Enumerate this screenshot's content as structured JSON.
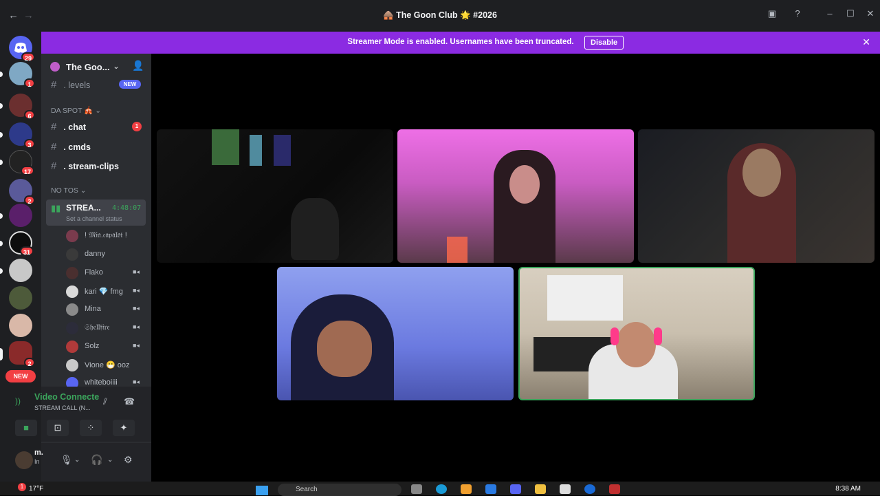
{
  "window": {
    "title": "🛖 The Goon Club 🌟 #2026",
    "back": "←",
    "forward": "→"
  },
  "banner": {
    "text": "Streamer Mode is enabled. Usernames have been truncated.",
    "button": "Disable"
  },
  "rail": {
    "home_badge": "29",
    "servers": [
      {
        "badge": "1"
      },
      {
        "badge": "6"
      },
      {
        "badge": "3"
      },
      {
        "badge": "17"
      },
      {
        "badge": "2"
      },
      {
        "badge": ""
      },
      {
        "badge": "31"
      },
      {
        "badge": ""
      },
      {
        "badge": ""
      },
      {
        "badge": ""
      },
      {
        "badge": "2"
      }
    ],
    "new_label": "NEW"
  },
  "server": {
    "name": "The Goo..."
  },
  "channels": {
    "levels": ". levels",
    "levels_pill": "NEW",
    "cat_spot": "DA SPOT 🎪",
    "chat": ". chat",
    "chat_badge": "1",
    "cmds": ". cmds",
    "clips": ". stream-clips",
    "cat_notos": "NO TOS"
  },
  "voice_channel": {
    "name": "STREA...",
    "timer": "4:48:07",
    "status": "Set a channel status"
  },
  "members": [
    {
      "name": "! 𝔐𝔦𝔞.𝔠𝔞𝔭𝔞𝔩𝔬𝔱 !",
      "color": "#7a3b4d",
      "cam": false
    },
    {
      "name": "danny",
      "color": "#3a3a3a",
      "cam": false
    },
    {
      "name": "Flako",
      "color": "#4a2f2f",
      "cam": true
    },
    {
      "name": "kari 💎 fmg",
      "color": "#d9d9d9",
      "cam": true
    },
    {
      "name": "Mina",
      "color": "#8a8a8a",
      "cam": true
    },
    {
      "name": "𝔖𝔥𝔢𝔩𝔩𝔣𝔦𝔯𝔢",
      "color": "#2c2c3a",
      "cam": true
    },
    {
      "name": "Solz",
      "color": "#b03a3a",
      "cam": true
    },
    {
      "name": "Vione 😷 ooz",
      "color": "#c9c9c9",
      "cam": false
    },
    {
      "name": "whiteboiiii",
      "color": "#5865f2",
      "cam": true
    }
  ],
  "voice_status": {
    "connected": "Video Connecte",
    "channel": "STREAM CALL (N..."
  },
  "user": {
    "name": "m.",
    "status": "In"
  },
  "taskbar": {
    "weather_badge": "1",
    "temperature": "17°F",
    "search": "Search",
    "time": "8:38 AM"
  },
  "colors": {
    "banner": "#8b2be2",
    "connected": "#3ba55c",
    "speaking_border": "#3ba55c",
    "badge": "#f23f43"
  }
}
